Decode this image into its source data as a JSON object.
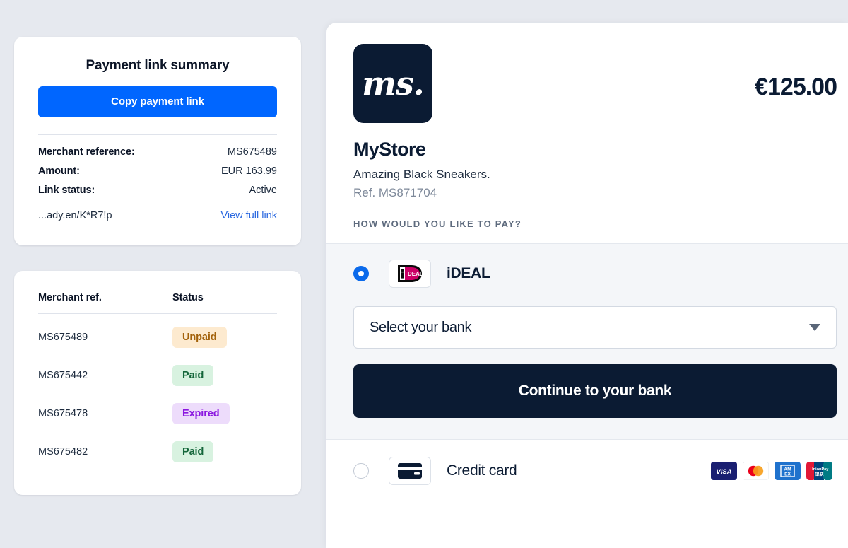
{
  "summary": {
    "title": "Payment link summary",
    "copy_button": "Copy payment link",
    "rows": [
      {
        "key": "Merchant reference:",
        "value": "MS675489"
      },
      {
        "key": "Amount:",
        "value": "EUR 163.99"
      },
      {
        "key": "Link status:",
        "value": "Active"
      }
    ],
    "link_url": "...ady.en/K*R7!p",
    "link_action": "View full link",
    "accent_color": "#0066ff",
    "link_color": "#2d6ae0"
  },
  "links_table": {
    "columns": [
      "Merchant ref.",
      "Status"
    ],
    "rows": [
      {
        "ref": "MS675489",
        "status": "Unpaid",
        "bg": "#fdeacf",
        "fg": "#a3620b"
      },
      {
        "ref": "MS675442",
        "status": "Paid",
        "bg": "#d8f2e0",
        "fg": "#14663a"
      },
      {
        "ref": "MS675478",
        "status": "Expired",
        "bg": "#eddcfb",
        "fg": "#8b17e0"
      },
      {
        "ref": "MS675482",
        "status": "Paid",
        "bg": "#d8f2e0",
        "fg": "#14663a"
      }
    ]
  },
  "checkout": {
    "logo_text": "ms.",
    "logo_bg": "#0b1b33",
    "amount": "€125.00",
    "store_name": "MyStore",
    "description": "Amazing Black Sneakers.",
    "reference": "Ref. MS871704",
    "pay_question": "HOW WOULD YOU LIKE TO PAY?",
    "methods": {
      "ideal": {
        "label": "iDEAL",
        "selected": true,
        "bank_placeholder": "Select your bank",
        "continue_label": "Continue to your bank",
        "brand_color": "#cc0066"
      },
      "credit_card": {
        "label": "Credit card",
        "selected": false,
        "brands": [
          "VISA",
          "Mastercard",
          "AMEX",
          "UnionPay"
        ]
      }
    }
  }
}
